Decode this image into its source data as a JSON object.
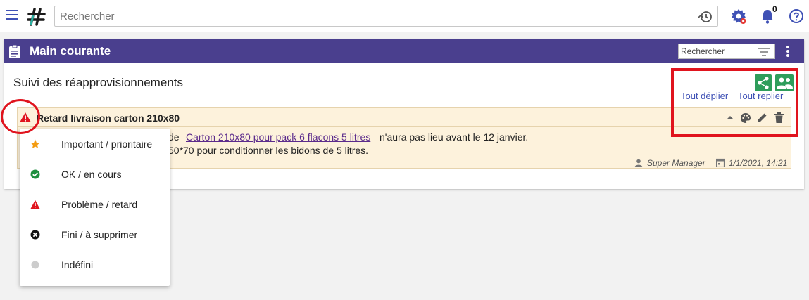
{
  "topbar": {
    "search_placeholder": "Rechercher",
    "notification_count": "0"
  },
  "card": {
    "title": "Main courante",
    "search_placeholder": "Rechercher",
    "section_title": "Suivi des réapprovisionnements",
    "expand_all": "Tout déplier",
    "collapse_all": "Tout replier"
  },
  "entry": {
    "title": "Retard livraison carton 210x80",
    "line1_lead": "de",
    "line1_link": "Carton 210x80 pour pack 6 flacons 5 litres",
    "line1_tail": "n'aura pas lieu avant le 12 janvier.",
    "line2_tail": "50*70 pour conditionner les bidons de 5 litres.",
    "author": "Super Manager",
    "date": "1/1/2021, 14:21"
  },
  "status_menu": {
    "items": [
      {
        "label": "Important / prioritaire",
        "icon": "star-icon",
        "color": "#f39c12"
      },
      {
        "label": "OK / en cours",
        "icon": "check-circle-icon",
        "color": "#1e8e3e"
      },
      {
        "label": "Problème / retard",
        "icon": "warning-icon",
        "color": "#e0141e"
      },
      {
        "label": "Fini / à supprimer",
        "icon": "cancel-circle-icon",
        "color": "#111111"
      },
      {
        "label": "Indéfini",
        "icon": "circle-icon",
        "color": "#cccccc"
      }
    ]
  },
  "colors": {
    "header": "#4a3f8e",
    "accent": "#3f51b5",
    "entry_bg": "#fdf2dc",
    "action_green": "#2e9d5b",
    "annotation_red": "#e0141e"
  }
}
